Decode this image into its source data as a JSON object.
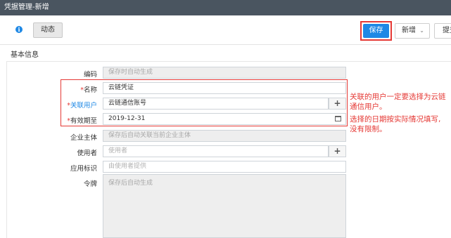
{
  "window": {
    "title": "凭据管理-新增"
  },
  "toolbar": {
    "dynamic_label": "动态",
    "save_label": "保存",
    "new_label": "新增",
    "submit_label": "提交"
  },
  "section": {
    "title": "基本信息"
  },
  "form": {
    "code": {
      "label": "编码",
      "value": "保存时自动生成"
    },
    "name": {
      "label": "名称",
      "value": "云链凭证"
    },
    "linked_user": {
      "label": "关联用户",
      "value": "云链通信账号"
    },
    "expiry": {
      "label": "有效期至",
      "value": "2019-12-31"
    },
    "enterprise": {
      "label": "企业主体",
      "value": "保存后自动关联当前企业主体"
    },
    "user": {
      "label": "使用者",
      "placeholder": "使用者"
    },
    "app_id": {
      "label": "应用标识",
      "placeholder": "由使用者提供"
    },
    "token": {
      "label": "令牌",
      "value": "保存后自动生成"
    },
    "required_mark": "*"
  },
  "annotations": {
    "line1": "关联的用户一定要选择为云链",
    "line2": "通信用户。",
    "line3": "选择的日期按实际情况填写,",
    "line4": "没有限制。"
  },
  "colors": {
    "accent": "#1e88e5",
    "highlight": "#e53935",
    "titlebar": "#4a5560"
  }
}
